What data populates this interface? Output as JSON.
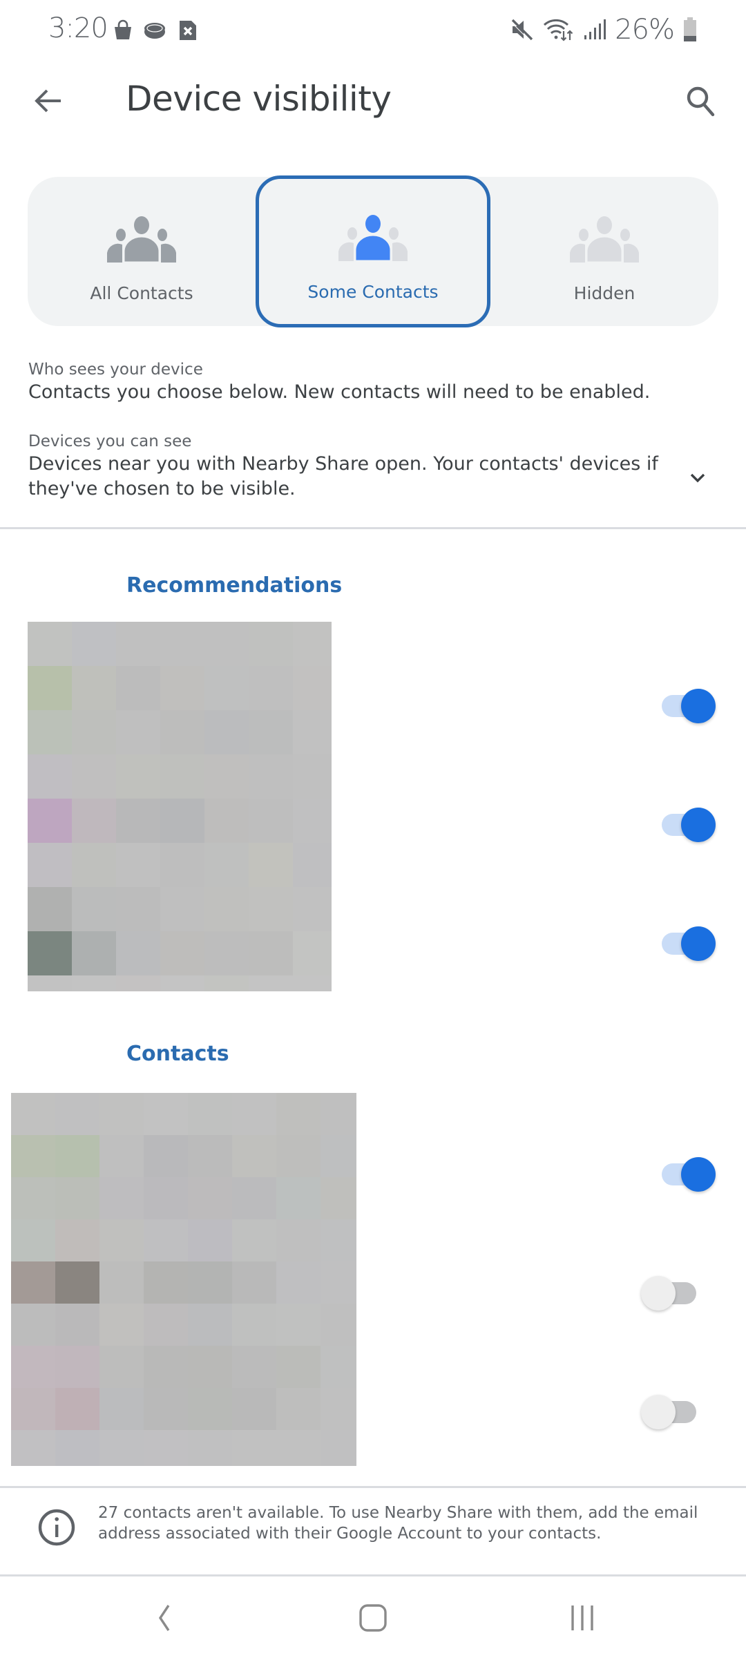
{
  "status_bar": {
    "time": "3:20",
    "left_icons": [
      "shopping-bag-icon",
      "stadia-puck-icon",
      "no-sim-icon"
    ],
    "right_icons": [
      "mute-icon",
      "wifi-data-icon",
      "signal-icon"
    ],
    "battery_percent": "26%",
    "battery_level": 0.26
  },
  "app_bar": {
    "title": "Device visibility",
    "back_icon": "arrow-back-icon",
    "search_icon": "search-icon"
  },
  "visibility_options": [
    {
      "label": "All Contacts",
      "selected": false
    },
    {
      "label": "Some Contacts",
      "selected": true
    },
    {
      "label": "Hidden",
      "selected": false
    }
  ],
  "who_sees": {
    "label": "Who sees your device",
    "value": "Contacts you choose below. New contacts will need to be enabled."
  },
  "devices_see": {
    "label": "Devices you can see",
    "value": "Devices near you with Nearby Share open. Your contacts' devices if they've chosen to be visible.",
    "expand_icon": "chevron-down-icon"
  },
  "recommendations": {
    "header": "Recommendations",
    "toggles": [
      true,
      true,
      true
    ]
  },
  "contacts": {
    "header": "Contacts",
    "toggles": [
      true,
      false,
      false
    ]
  },
  "notice": {
    "icon": "info-icon",
    "text": "27 contacts aren't available. To use Nearby Share with them, add the email address associated with their Google Account to your contacts."
  },
  "nav_bar": {
    "back": "nav-back-icon",
    "home": "nav-home-icon",
    "recents": "nav-recents-icon"
  },
  "colors": {
    "accent": "#2b6cb5",
    "toggle_on": "#1a6fe0",
    "toggle_on_track": "#c9dcf7",
    "toggle_off_track": "#c4c5c7",
    "card_bg": "#f1f3f4"
  }
}
